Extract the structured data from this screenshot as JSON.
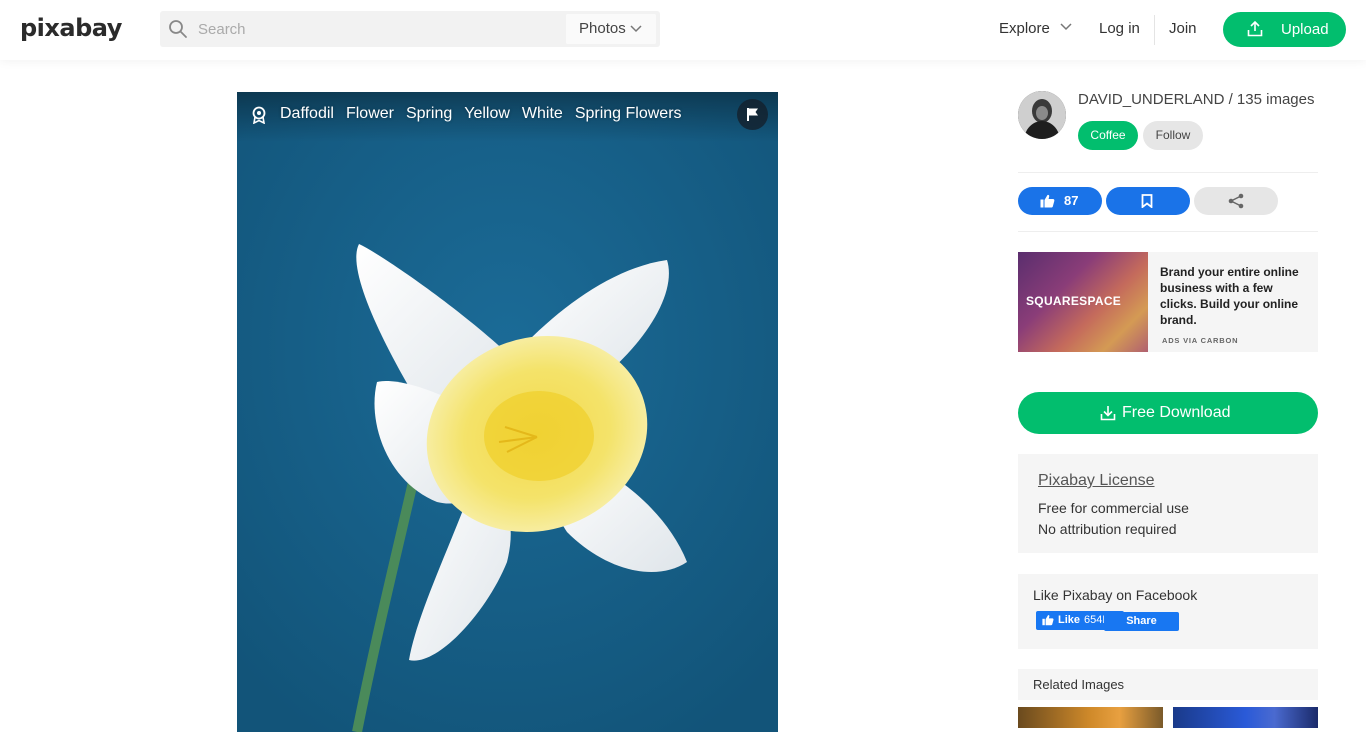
{
  "header": {
    "logo": "pixabay",
    "search_placeholder": "Search",
    "search_category": "Photos",
    "explore": "Explore",
    "login": "Log in",
    "join": "Join",
    "upload": "Upload"
  },
  "photo": {
    "tags": [
      "Daffodil",
      "Flower",
      "Spring",
      "Yellow",
      "White",
      "Spring Flowers"
    ]
  },
  "author": {
    "name_line": "DAVID_UNDERLAND / 135 images",
    "coffee": "Coffee",
    "follow": "Follow"
  },
  "actions": {
    "likes": "87"
  },
  "ad": {
    "brand": "SQUARESPACE",
    "text": "Brand your entire online business with a few clicks. Build your online brand.",
    "via": "ADS VIA CARBON"
  },
  "download": {
    "label": "Free Download"
  },
  "license": {
    "title": "Pixabay License",
    "line1": "Free for commercial use",
    "line2": "No attribution required"
  },
  "facebook": {
    "title": "Like Pixabay on Facebook",
    "like_label": "Like",
    "like_count": "654K",
    "share_label": "Share"
  },
  "related": {
    "title": "Related Images"
  },
  "colors": {
    "brand_green": "#02be6e",
    "action_blue": "#1a73e8",
    "photo_background": "#19618d"
  }
}
